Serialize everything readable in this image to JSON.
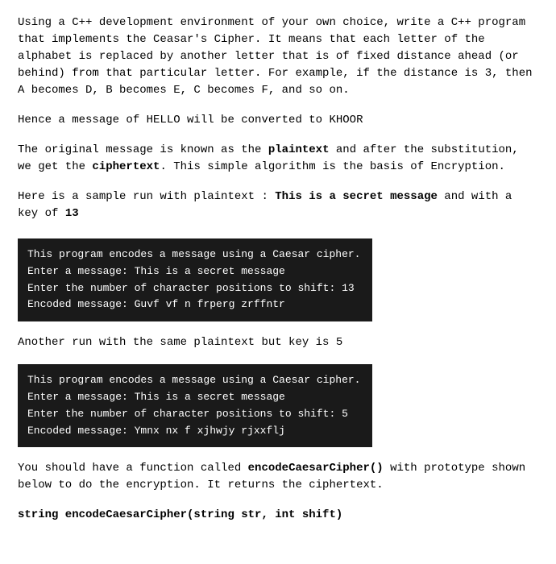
{
  "intro": {
    "paragraph1": "Using a C++ development environment of your own choice, write a C++ program that implements the Ceasar's Cipher. It means that each letter of the alphabet is replaced by another letter that is of fixed distance ahead (or behind) from that particular letter. For example, if the distance is 3, then A becomes D, B becomes E, C becomes F, and so on.",
    "paragraph2": "Hence a message of HELLO will be converted to KHOOR",
    "paragraph3_part1": "The original message is known as the ",
    "bold1": "plaintext",
    "paragraph3_part2": " and after the substitution, we get the ",
    "bold2": "ciphertext",
    "paragraph3_part3": ". This simple algorithm is the basis of Encryption.",
    "paragraph4_part1": "Here is a sample run with plaintext : ",
    "bold3": "This is a secret message",
    "paragraph4_part2": " and with a key of ",
    "bold4": "13"
  },
  "terminal1": {
    "line1": "This program encodes a message using a Caesar cipher.",
    "line2": "Enter a message: This is a secret message",
    "line3": "Enter the number of character positions to shift: 13",
    "line4": "",
    "line5": "Encoded message: Guvf vf n frperg zrffntr"
  },
  "run2": {
    "label": "Another run with the same plaintext but key is 5"
  },
  "terminal2": {
    "line1": "This program encodes a message using a Caesar cipher.",
    "line2": "Enter a message: This is a secret message",
    "line3": "Enter the number of character positions to shift: 5",
    "line4": "",
    "line5": "Encoded message: Ymnx nx f xjhwjy rjxxflj"
  },
  "outro": {
    "paragraph1_part1": "You should have a function called ",
    "bold1": "encodeCaesarCipher()",
    "paragraph1_part2": " with prototype shown below to do the encryption. It returns the ciphertext.",
    "function_sig": "string encodeCaesarCipher(string str, int shift)"
  }
}
